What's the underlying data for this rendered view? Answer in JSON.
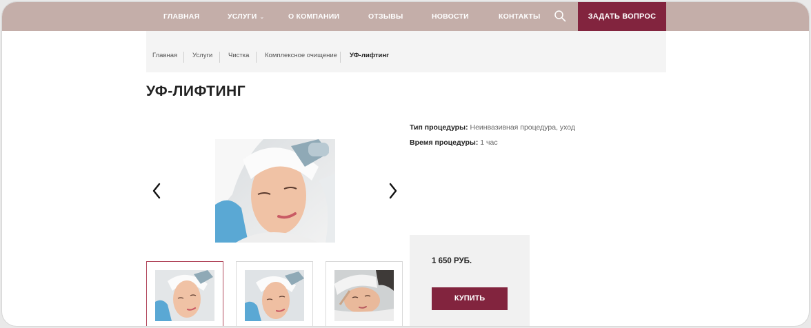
{
  "nav": {
    "items": [
      {
        "label": "ГЛАВНАЯ"
      },
      {
        "label": "УСЛУГИ",
        "has_dropdown": true
      },
      {
        "label": "О КОМПАНИИ"
      },
      {
        "label": "ОТЗЫВЫ"
      },
      {
        "label": "НОВОСТИ"
      },
      {
        "label": "КОНТАКТЫ"
      }
    ],
    "search_icon": "search-icon",
    "ask_button": "ЗАДАТЬ ВОПРОС"
  },
  "breadcrumb": [
    "Главная",
    "Услуги",
    "Чистка",
    "Комплексное очищение",
    "УФ-лифтинг"
  ],
  "title": "УФ-ЛИФТИНГ",
  "gallery": {
    "prev_icon": "chevron-left-icon",
    "next_icon": "chevron-right-icon",
    "thumbnails": 3,
    "active_thumbnail": 0
  },
  "details": {
    "type_label": "Тип процедуры:",
    "type_value": "Неинвазивная процедура, уход",
    "time_label": "Время процедуры:",
    "time_value": "1 час"
  },
  "purchase": {
    "price": "1 650 РУБ.",
    "buy_button": "КУПИТЬ"
  },
  "colors": {
    "nav_bg": "#c4aea9",
    "accent": "#82243e",
    "active_thumb_border": "#b2485c"
  }
}
